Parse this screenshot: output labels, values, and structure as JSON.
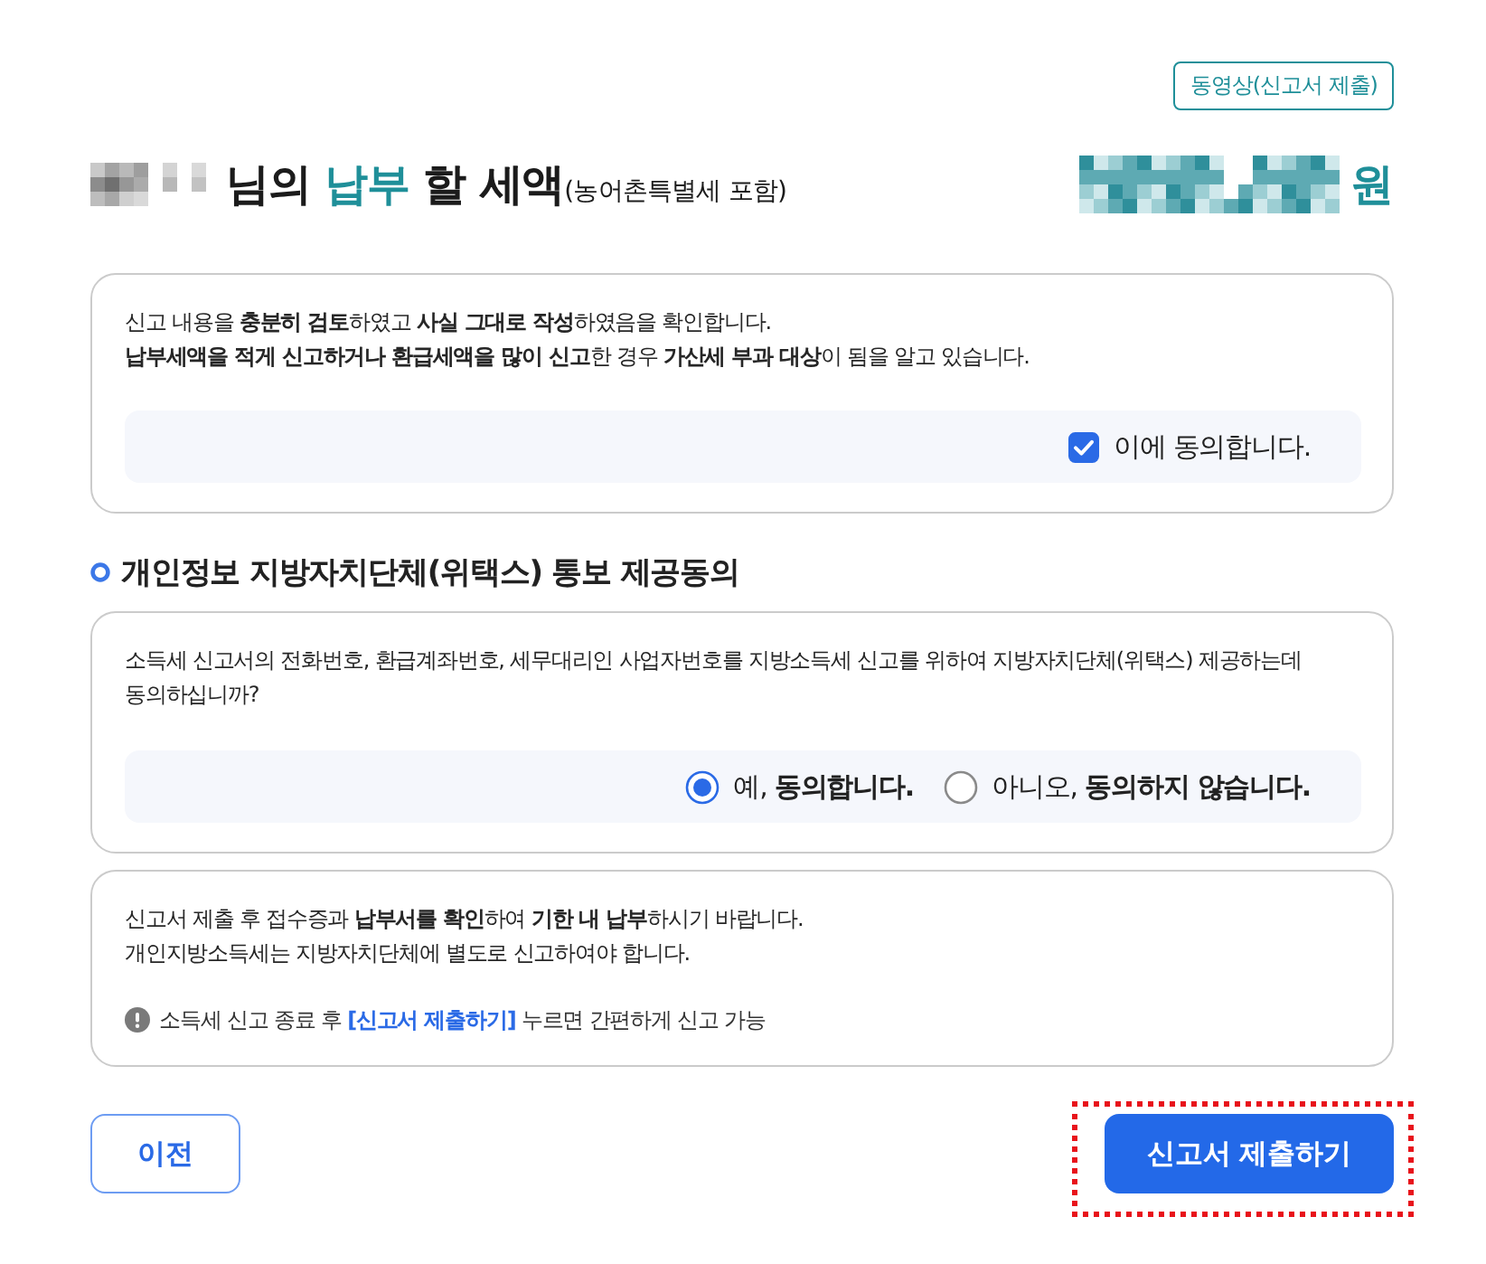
{
  "video_button": {
    "label": "동영상(신고서 제출)"
  },
  "title": {
    "text": "님의",
    "highlight": "납부",
    "rest": "할 세액",
    "note": "(농어촌특별세 포함)",
    "currency": "원"
  },
  "confirm_card": {
    "lines": [
      "신고 내용을 **충분히 검토**하였고 **사실 그대로 작성**하였음을 확인합니다.",
      "**납부세액을 적게 신고하거나 환급세액을 많이 신고**한 경우 **가산세 부과 대상**이 됨을 알고 있습니다."
    ],
    "checkbox": {
      "label": "이에 동의합니다.",
      "checked": true
    }
  },
  "privacy_section": {
    "heading": "개인정보 지방자치단체(위택스) 통보 제공동의",
    "question": "소득세 신고서의 전화번호, 환급계좌번호, 세무대리인 사업자번호를 지방소득세 신고를 위하여 지방자치단체(위택스) 제공하는데 동의하십니까?",
    "options": [
      {
        "label": "예, **동의합니다.**",
        "selected": true
      },
      {
        "label": "아니오, **동의하지 않습니다.**",
        "selected": false
      }
    ]
  },
  "info_card": {
    "lines": [
      "신고서 제출 후 접수증과 **납부서를 확인**하여 **기한 내 납부**하시기 바랍니다.",
      "개인지방소득세는 지방자치단체에 별도로 신고하여야 합니다."
    ],
    "notice": {
      "before": "소득세 신고 종료 후",
      "link": "[신고서 제출하기]",
      "after": "누르면 간편하게 신고 가능"
    }
  },
  "buttons": [
    {
      "kind": "secondary",
      "label": "이전",
      "highlighted": false
    },
    {
      "kind": "primary",
      "label": "신고서 제출하기",
      "highlighted": true
    }
  ]
}
